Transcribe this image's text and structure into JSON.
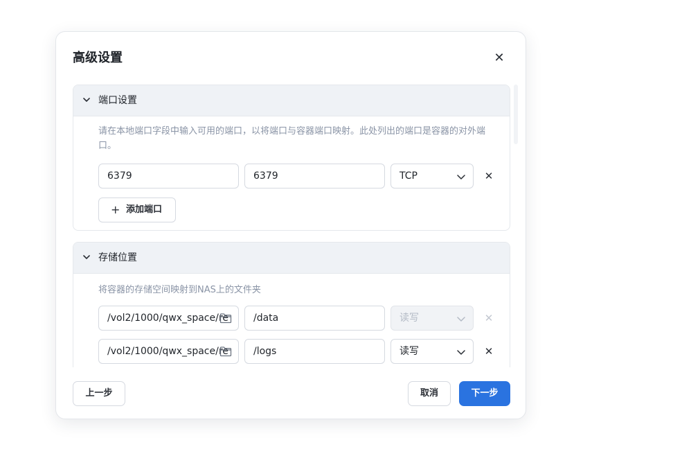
{
  "dialog": {
    "title": "高级设置",
    "close_icon": "close-icon"
  },
  "ports": {
    "title": "端口设置",
    "description": "请在本地端口字段中输入可用的端口，以将端口与容器端口映射。此处列出的端口是容器的对外端口。",
    "rows": [
      {
        "local_port": "6379",
        "container_port": "6379",
        "protocol": "TCP"
      }
    ],
    "add_button_label": "添加端口"
  },
  "storage": {
    "title": "存储位置",
    "description": "将容器的存储空间映射到NAS上的文件夹",
    "rows": [
      {
        "host_path": "/vol2/1000/qwx_space/re",
        "container_path": "/data",
        "permission": "读写",
        "disabled": true
      },
      {
        "host_path": "/vol2/1000/qwx_space/re",
        "container_path": "/logs",
        "permission": "读写",
        "disabled": false
      }
    ]
  },
  "footer": {
    "prev_label": "上一步",
    "cancel_label": "取消",
    "next_label": "下一步"
  },
  "colors": {
    "primary": "#2a73e0",
    "header_bg": "#eff2f6",
    "muted_text": "#8a94a6"
  }
}
